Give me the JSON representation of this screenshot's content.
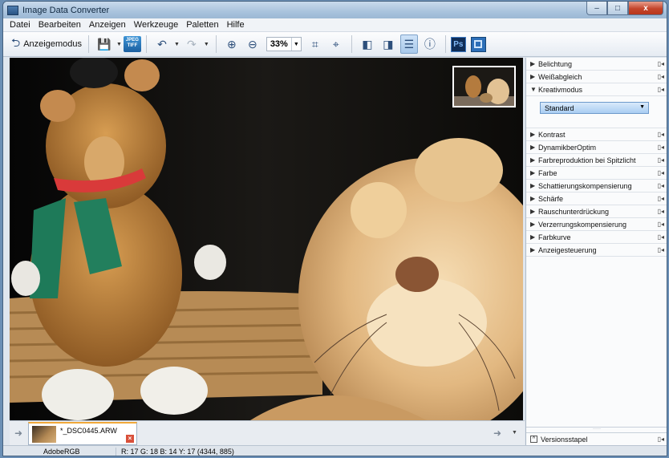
{
  "window": {
    "title": "Image Data Converter",
    "buttons": {
      "minimize": "–",
      "maximize": "□",
      "close": "x"
    }
  },
  "menu": [
    "Datei",
    "Bearbeiten",
    "Anzeigen",
    "Werkzeuge",
    "Paletten",
    "Hilfe"
  ],
  "toolbar": {
    "display_mode_label": "Anzeigemodus",
    "zoom_value": "33%",
    "jpeg_tiff_label": "JPEG TIFF",
    "photoshop_label": "Ps"
  },
  "palette": {
    "items_top": [
      {
        "label": "Belichtung",
        "expanded": false
      },
      {
        "label": "Weißabgleich",
        "expanded": false
      },
      {
        "label": "Kreativmodus",
        "expanded": true
      }
    ],
    "creative_mode_value": "Standard",
    "items_bottom": [
      {
        "label": "Kontrast"
      },
      {
        "label": "DynamikberOptim"
      },
      {
        "label": "Farbreproduktion bei Spitzlicht"
      },
      {
        "label": "Farbe"
      },
      {
        "label": "Schattierungskompensierung"
      },
      {
        "label": "Schärfe"
      },
      {
        "label": "Rauschunterdrückung"
      },
      {
        "label": "Verzerrungskompensierung"
      },
      {
        "label": "Farbkurve"
      },
      {
        "label": "Anzeigesteuerung"
      }
    ],
    "version_stack_label": "Versionsstapel"
  },
  "filmstrip": {
    "file_name": "*_DSC0445.ARW"
  },
  "status": {
    "color_space": "AdobeRGB",
    "pixel_info": "R: 17  G: 18  B: 14  Y: 17   (4344, 885)"
  }
}
